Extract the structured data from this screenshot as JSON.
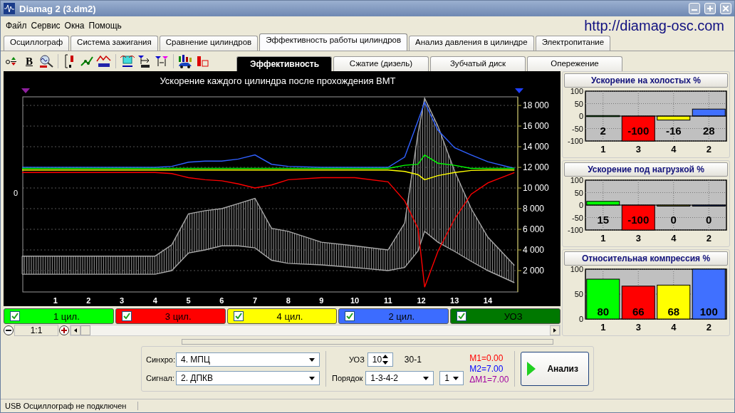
{
  "window": {
    "title": "Diamag 2 (3.dm2)"
  },
  "menu": [
    "Файл",
    "Сервис",
    "Окна",
    "Помощь"
  ],
  "website": "http://diamag-osc.com",
  "tabs": [
    {
      "label": "Осциллограф",
      "selected": false
    },
    {
      "label": "Система зажигания",
      "selected": false
    },
    {
      "label": "Сравнение цилиндров",
      "selected": false
    },
    {
      "label": "Эффективность работы цилиндров",
      "selected": true
    },
    {
      "label": "Анализ давления в цилиндре",
      "selected": false
    },
    {
      "label": "Электропитание",
      "selected": false
    }
  ],
  "toolbar": [
    {
      "kind": "zero"
    },
    {
      "kind": "bold",
      "text": "B"
    },
    {
      "kind": "rpm"
    },
    {
      "kind": "scale"
    },
    {
      "kind": "line"
    },
    {
      "kind": "zigzag"
    },
    {
      "kind": "cylinder"
    },
    {
      "kind": "marker"
    },
    {
      "kind": "marker-width"
    },
    {
      "kind": "car"
    },
    {
      "kind": "bar"
    }
  ],
  "subtabs": [
    {
      "label": "Эффективность",
      "selected": true
    },
    {
      "label": "Сжатие (дизель)",
      "selected": false
    },
    {
      "label": "Зубчатый диск",
      "selected": false
    },
    {
      "label": "Опережение",
      "selected": false
    }
  ],
  "main_chart": {
    "left_label": "0",
    "chart_data": {
      "type": "line",
      "title": "Ускорение каждого цилиндра после прохождения ВМТ",
      "x": [
        0,
        1,
        2,
        3,
        4,
        4.5,
        5,
        5.5,
        6,
        6.5,
        7,
        7.5,
        8,
        9,
        10,
        11,
        11.5,
        11.9,
        12.1,
        12.5,
        13,
        13.5,
        14,
        14.8
      ],
      "xlim": [
        0,
        14.9
      ],
      "ylim": [
        0,
        18900
      ],
      "grid": true,
      "xticks": [
        1,
        2,
        3,
        4,
        5,
        6,
        7,
        8,
        9,
        10,
        11,
        12,
        13,
        14
      ],
      "yticks": [
        {
          "value": 2000,
          "label": "2 000"
        },
        {
          "value": 4000,
          "label": "4 000"
        },
        {
          "value": 6000,
          "label": "6 000"
        },
        {
          "value": 8000,
          "label": "8 000"
        },
        {
          "value": 10000,
          "label": "10 000"
        },
        {
          "value": 12000,
          "label": "12 000"
        },
        {
          "value": 14000,
          "label": "14 000"
        },
        {
          "value": 16000,
          "label": "16 000"
        },
        {
          "value": 18000,
          "label": "18 000"
        }
      ],
      "series": [
        {
          "color": "#a8a8a8",
          "values": [
            3400,
            3400,
            3400,
            3400,
            3400,
            4500,
            7500,
            7800,
            8000,
            8500,
            9000,
            6100,
            5800,
            4750,
            4400,
            4000,
            6600,
            15300,
            18700,
            16000,
            11650,
            8000,
            5240,
            2500
          ]
        },
        {
          "color": "#a8a8a8",
          "values": [
            1650,
            1650,
            1650,
            1650,
            1650,
            2000,
            3700,
            4000,
            4400,
            4400,
            4200,
            3000,
            2700,
            2550,
            2300,
            2000,
            2300,
            3900,
            5800,
            4750,
            3860,
            2900,
            2000,
            830
          ]
        },
        {
          "color": "#3060ff",
          "values": [
            12000,
            12000,
            12000,
            12000,
            12000,
            12100,
            12500,
            12600,
            12600,
            12800,
            13200,
            12300,
            12100,
            12000,
            12000,
            12000,
            13000,
            16500,
            18300,
            15600,
            13900,
            13200,
            12550,
            11900
          ]
        },
        {
          "color": "#ff0000",
          "values": [
            11500,
            11500,
            11500,
            11500,
            11500,
            11400,
            11000,
            10800,
            10700,
            10400,
            10000,
            10300,
            10800,
            11000,
            11000,
            10600,
            8750,
            6100,
            400,
            3860,
            7000,
            9400,
            10500,
            11500
          ]
        },
        {
          "color": "#00ff00",
          "values": [
            11900,
            11900,
            11900,
            11900,
            11900,
            11900,
            11900,
            11900,
            11900,
            11900,
            11900,
            11900,
            11900,
            11900,
            11900,
            11900,
            12200,
            12300,
            13200,
            12400,
            12200,
            11900,
            11900,
            11900
          ]
        },
        {
          "color": "#ffff00",
          "values": [
            11750,
            11750,
            11750,
            11750,
            11750,
            11750,
            11750,
            11750,
            11750,
            11750,
            11750,
            11750,
            11750,
            11750,
            11750,
            11750,
            11600,
            11300,
            10800,
            11200,
            11500,
            11700,
            11750,
            11750
          ]
        }
      ]
    }
  },
  "legend": [
    {
      "label": "1 цил.",
      "color": "#00ff00",
      "checked": true
    },
    {
      "label": "3 цил.",
      "color": "#ff0000",
      "checked": true
    },
    {
      "label": "4 цил.",
      "color": "#ffff00",
      "checked": true
    },
    {
      "label": "2 цил.",
      "color": "#3c6cff",
      "checked": true
    },
    {
      "label": "УОЗ",
      "color": "#007800",
      "checked": true
    }
  ],
  "zoom": {
    "value": "1:1"
  },
  "bar_panels": [
    {
      "title": "Ускорение на холостых %",
      "chart_data": {
        "type": "bar",
        "categories": [
          "1",
          "3",
          "4",
          "2"
        ],
        "values": [
          2,
          -100,
          -16,
          28
        ],
        "colors": [
          "#00ff00",
          "#ff0000",
          "#ffff00",
          "#4070ff"
        ],
        "ylim": [
          -100,
          100
        ],
        "grid": true,
        "yticks": [
          100,
          50,
          0,
          -50,
          -100
        ],
        "data_labels": true
      }
    },
    {
      "title": "Ускорение под нагрузкой %",
      "chart_data": {
        "type": "bar",
        "categories": [
          "1",
          "3",
          "4",
          "2"
        ],
        "values": [
          15,
          -100,
          0,
          0
        ],
        "colors": [
          "#00ff00",
          "#ff0000",
          "#ffff00",
          "#4070ff"
        ],
        "ylim": [
          -100,
          100
        ],
        "grid": true,
        "yticks": [
          100,
          50,
          0,
          -50,
          -100
        ],
        "data_labels": true
      }
    },
    {
      "title": "Относительная компрессия %",
      "chart_data": {
        "type": "bar",
        "categories": [
          "1",
          "3",
          "4",
          "2"
        ],
        "values": [
          80,
          66,
          68,
          100
        ],
        "colors": [
          "#00ff00",
          "#ff0000",
          "#ffff00",
          "#4070ff"
        ],
        "ylim": [
          0,
          100
        ],
        "grid": true,
        "yticks": [
          100,
          50,
          0
        ],
        "data_labels": true
      }
    }
  ],
  "controls": {
    "sync": {
      "label": "Синхро:",
      "value": "4.  МПЦ"
    },
    "signal": {
      "label": "Сигнал:",
      "value": "2.  ДПКВ"
    },
    "uoz": {
      "label": "УОЗ",
      "value": "10"
    },
    "teeth": "30-1",
    "order": {
      "label": "Порядок",
      "value": "1-3-4-2"
    },
    "order_start": "1",
    "measures": [
      {
        "text": "M1=0.00",
        "color": "#ff0000"
      },
      {
        "text": "M2=7.00",
        "color": "#0000ff"
      },
      {
        "text": "ΔM1=7.00",
        "color": "#a000a0"
      }
    ],
    "analyze": "Анализ"
  },
  "status_bar": "USB Осциллограф не подключен"
}
